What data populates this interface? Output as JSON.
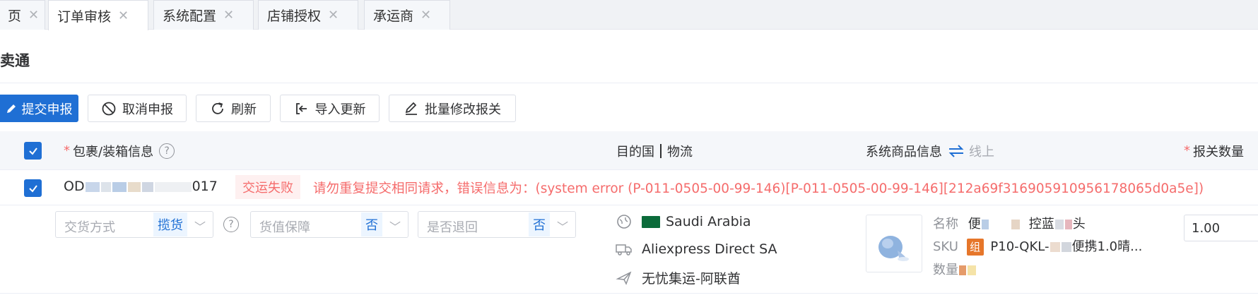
{
  "tabs": [
    {
      "label": "页"
    },
    {
      "label": "订单审核"
    },
    {
      "label": "系统配置"
    },
    {
      "label": "店铺授权"
    },
    {
      "label": "承运商"
    }
  ],
  "page": {
    "title": "卖通"
  },
  "toolbar": {
    "submit": "提交申报",
    "cancel": "取消申报",
    "refresh": "刷新",
    "import": "导入更新",
    "batch_edit": "批量修改报关"
  },
  "table": {
    "headers": {
      "package_info": "包裹/装箱信息",
      "destination": "目的国",
      "logistics": "物流",
      "product_info": "系统商品信息",
      "online": "线上",
      "declare_qty": "报关数量"
    }
  },
  "order": {
    "id_prefix": "OD",
    "id_suffix": "017",
    "status_tag": "交运失败",
    "error_message": "请勿重复提交相同请求，错误信息为：(system error (P-011-0505-00-99-146)[P-011-0505-00-99-146][212a69f316905910956178065d0a5e])",
    "delivery_method": {
      "placeholder": "交货方式",
      "value": "揽货"
    },
    "value_guarantee": {
      "placeholder": "货值保障",
      "value": "否"
    },
    "return_option": {
      "placeholder": "是否退回",
      "value": "否"
    },
    "country": "Saudi Arabia",
    "carrier": "Aliexpress Direct SA",
    "channel": "无忧集运-阿联酋",
    "product": {
      "name_label": "名称",
      "name_value_a": "便",
      "name_value_b": "控蓝",
      "name_value_c": "头",
      "sku_label": "SKU",
      "sku_tag": "组",
      "sku_value_a": "P1",
      "sku_value_b": "0-QKL-",
      "sku_value_c": "便携1.0晴...",
      "qty_label": "数量"
    },
    "declare_qty": "1.00"
  },
  "colors": {
    "primary": "#1f6fd4",
    "error": "#f56c6c",
    "tag_orange": "#e6762a"
  }
}
